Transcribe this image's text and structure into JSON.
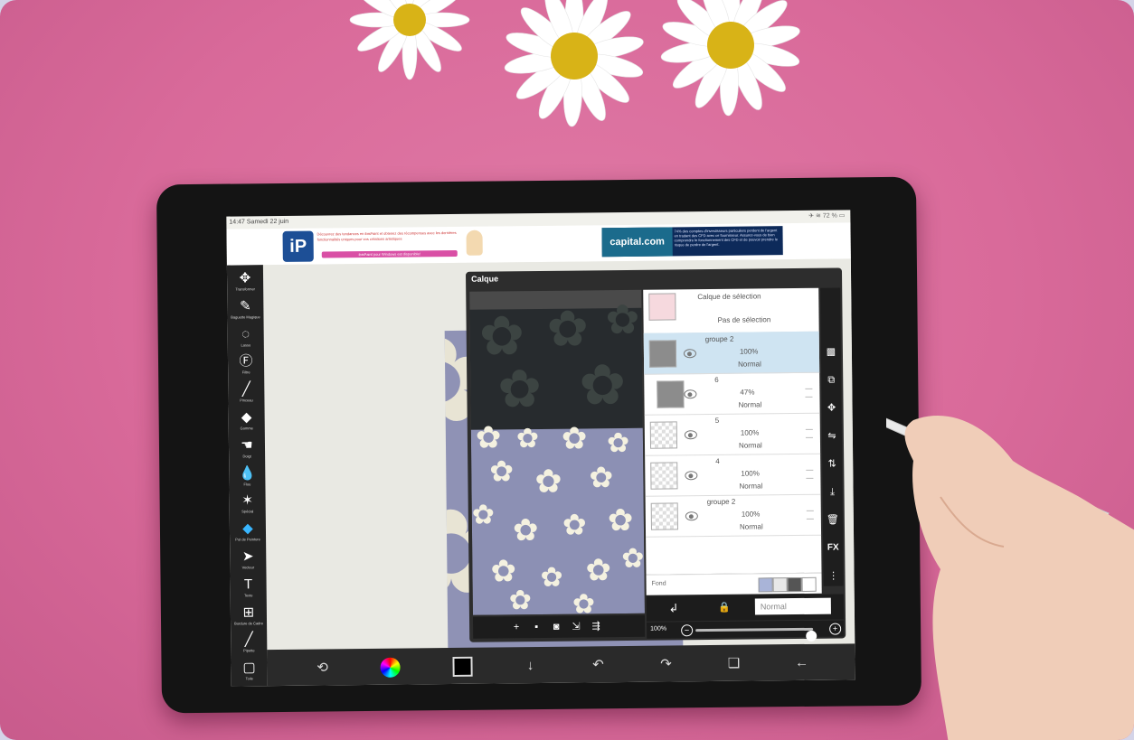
{
  "status_bar": {
    "time_date": "14:47  Samedi 22 juin",
    "right": "✈ ≋ 72 % ▭"
  },
  "ad_banner": {
    "app_logo": "iP",
    "ad1_text": "Découvrez des tendances en ibisPaint et obtenez des récompenses avec les dernières fonctionnalités uniques pour vos créations artistiques",
    "ad1_button": "ibisPaint pour Windows est disponible!",
    "ad2_logo": "capital.com",
    "ad2_text": "74% des comptes d'investisseurs particuliers perdent de l'argent en tradant des CFD avec ce fournisseur. Assurez-vous de bien comprendre le fonctionnement des CFD et de pouvoir prendre le risque de perdre de l'argent."
  },
  "tools": [
    {
      "icon": "move-icon",
      "glyph": "✥",
      "label": "Transformer"
    },
    {
      "icon": "magic-wand-icon",
      "glyph": "✎",
      "label": "Baguette Magique"
    },
    {
      "icon": "lasso-icon",
      "glyph": "◌",
      "label": "Lasso"
    },
    {
      "icon": "filter-icon",
      "glyph": "Ⓕ",
      "label": "Filtre"
    },
    {
      "icon": "brush-icon",
      "glyph": "╱",
      "label": "Pinceau"
    },
    {
      "icon": "eraser-icon",
      "glyph": "◆",
      "label": "Gomme"
    },
    {
      "icon": "smudge-icon",
      "glyph": "☚",
      "label": "Doigt"
    },
    {
      "icon": "blur-icon",
      "glyph": "💧",
      "label": "Flou"
    },
    {
      "icon": "special-icon",
      "glyph": "✶",
      "label": "Spécial"
    },
    {
      "icon": "fill-icon",
      "glyph": "◆",
      "label": "Pot de Peinture"
    },
    {
      "icon": "cursor-icon",
      "glyph": "➤",
      "label": "Vecteur"
    },
    {
      "icon": "text-icon",
      "glyph": "T",
      "label": "Texte"
    },
    {
      "icon": "frame-icon",
      "glyph": "⊞",
      "label": "Bordure de Cadre"
    },
    {
      "icon": "eyedropper-icon",
      "glyph": "╱",
      "label": "Pipette"
    },
    {
      "icon": "canvas-icon",
      "glyph": "▢",
      "label": "Toile"
    }
  ],
  "active_tool_index": 9,
  "layer_panel": {
    "title": "Calque",
    "selection_layer": {
      "name": "Calque de sélection",
      "status": "Pas de sélection"
    },
    "layers": [
      {
        "name": "groupe 2",
        "opacity": "100%",
        "mode": "Normal",
        "selected": true
      },
      {
        "name": "6",
        "opacity": "47%",
        "mode": "Normal",
        "selected": false
      },
      {
        "name": "5",
        "opacity": "100%",
        "mode": "Normal",
        "selected": false
      },
      {
        "name": "4",
        "opacity": "100%",
        "mode": "Normal",
        "selected": false
      },
      {
        "name": "groupe 2",
        "opacity": "100%",
        "mode": "Normal",
        "selected": false
      }
    ],
    "fond_label": "Fond",
    "fond_swatches": [
      "#a9b4d8",
      "#e8e8e8",
      "#555555",
      "#ffffff"
    ],
    "blend_mode": "Normal",
    "opacity_label": "100%",
    "opacity_value": 1.0,
    "right_tools": [
      {
        "icon": "checker-icon",
        "glyph": "▩"
      },
      {
        "icon": "copy-layer-icon",
        "glyph": "⧉"
      },
      {
        "icon": "move-layer-icon",
        "glyph": "✥"
      },
      {
        "icon": "flip-horizontal-icon",
        "glyph": "⇋"
      },
      {
        "icon": "flip-vertical-icon",
        "glyph": "⇅"
      },
      {
        "icon": "merge-down-icon",
        "glyph": "⤓"
      },
      {
        "icon": "trash-icon",
        "glyph": "🗑"
      },
      {
        "icon": "fx-icon",
        "glyph": "FX"
      },
      {
        "icon": "more-icon",
        "glyph": "⋮"
      }
    ],
    "preview_buttons": [
      {
        "icon": "add-layer-icon",
        "glyph": "+"
      },
      {
        "icon": "add-folder-icon",
        "glyph": "▪"
      },
      {
        "icon": "camera-icon",
        "glyph": "◙"
      },
      {
        "icon": "import-icon",
        "glyph": "⇲"
      },
      {
        "icon": "export-icon",
        "glyph": "⇶"
      }
    ]
  },
  "bottom_bar": [
    {
      "icon": "transform-icon",
      "glyph": "⟲"
    },
    {
      "icon": "color-wheel-icon",
      "glyph": ""
    },
    {
      "icon": "color-swatch-icon",
      "glyph": ""
    },
    {
      "icon": "down-arrow-icon",
      "glyph": "↓"
    },
    {
      "icon": "undo-icon",
      "glyph": "↶"
    },
    {
      "icon": "redo-icon",
      "glyph": "↷"
    },
    {
      "icon": "layers-icon",
      "glyph": "❏"
    },
    {
      "icon": "back-icon",
      "glyph": "←"
    }
  ],
  "colors": {
    "background_pink": "#d96a9a",
    "accent": "#39b6ff",
    "selected_layer": "#cfe4f2",
    "paper_lavender": "#8f92b5"
  }
}
